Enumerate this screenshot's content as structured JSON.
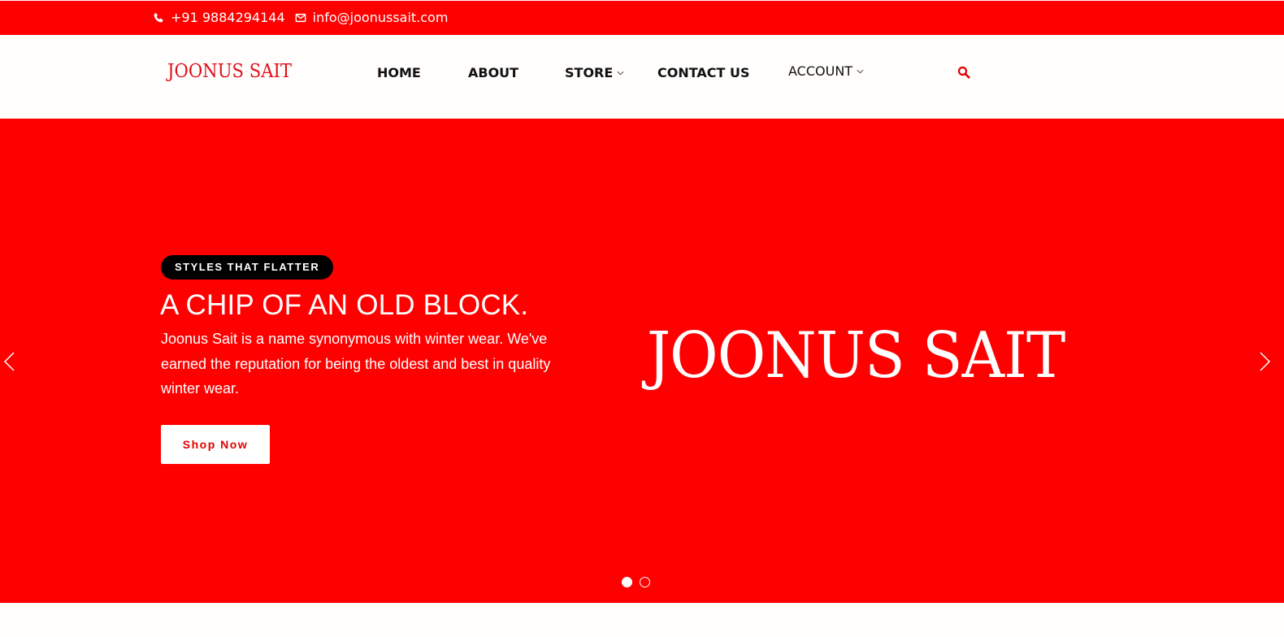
{
  "topbar": {
    "phone": "+91 9884294144",
    "email": "info@joonussait.com",
    "phone_icon": "phone-icon",
    "email_icon": "envelope-icon"
  },
  "header": {
    "logo": "JOONUS SAIT",
    "nav": {
      "home": "HOME",
      "about": "ABOUT",
      "store": "STORE",
      "contact": "CONTACT US",
      "account": "ACCOUNT"
    },
    "search_icon": "search-icon"
  },
  "hero": {
    "badge": "STYLES THAT FLATTER",
    "title": "A CHIP OF AN OLD BLOCK.",
    "description": "Joonus Sait is a name synonymous with winter wear. We've earned the reputation for being the oldest and best in quality winter wear.",
    "button": "Shop Now",
    "brand_image_text": "JOONUS SAIT",
    "slides": 2,
    "active_slide": 1
  },
  "colors": {
    "brand_red": "#ff0000",
    "text_dark": "#111111",
    "white": "#ffffff"
  }
}
